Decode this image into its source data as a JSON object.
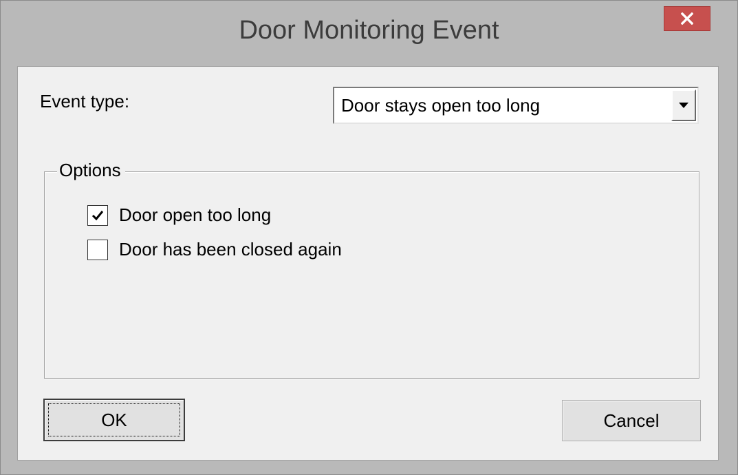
{
  "window": {
    "title": "Door Monitoring Event",
    "close_icon": "close-icon",
    "close_color": "#c7504e"
  },
  "event_type": {
    "label": "Event type:",
    "selected": "Door stays open too long",
    "dropdown_icon": "dropdown-arrow-icon"
  },
  "options": {
    "group_label": "Options",
    "items": [
      {
        "label": "Door open too long",
        "checked": true
      },
      {
        "label": "Door has been closed again",
        "checked": false
      }
    ]
  },
  "buttons": {
    "ok_label": "OK",
    "cancel_label": "Cancel"
  }
}
